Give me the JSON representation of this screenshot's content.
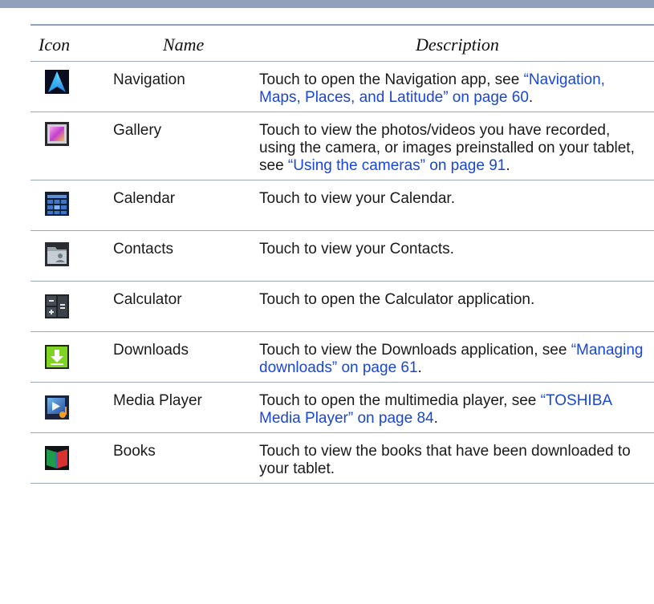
{
  "table": {
    "headers": {
      "icon": "Icon",
      "name": "Name",
      "description": "Description"
    },
    "rows": [
      {
        "icon": "navigation-arrow-icon",
        "name": "Navigation",
        "desc_prefix": "Touch to open the Navigation app, see ",
        "desc_link": "“Navigation, Maps, Places, and Latitude” on page 60",
        "desc_suffix": "."
      },
      {
        "icon": "gallery-picture-icon",
        "name": "Gallery",
        "desc_prefix": "Touch to view the photos/videos you have recorded, using the camera, or images preinstalled on your tablet, see ",
        "desc_link": "“Using the cameras” on page 91",
        "desc_suffix": "."
      },
      {
        "icon": "calendar-grid-icon",
        "name": "Calendar",
        "desc_prefix": "Touch to view your Calendar.",
        "desc_link": "",
        "desc_suffix": ""
      },
      {
        "icon": "contacts-folder-icon",
        "name": "Contacts",
        "desc_prefix": "Touch to view your Contacts.",
        "desc_link": "",
        "desc_suffix": ""
      },
      {
        "icon": "calculator-keys-icon",
        "name": "Calculator",
        "desc_prefix": "Touch to open the Calculator application.",
        "desc_link": "",
        "desc_suffix": ""
      },
      {
        "icon": "download-arrow-icon",
        "name": "Downloads",
        "desc_prefix": "Touch to view the Downloads application, see ",
        "desc_link": "“Managing downloads” on page 61",
        "desc_suffix": "."
      },
      {
        "icon": "media-player-film-icon",
        "name": "Media Player",
        "desc_prefix": "Touch to open the multimedia player, see ",
        "desc_link": "“TOSHIBA Media Player” on page 84",
        "desc_suffix": "."
      },
      {
        "icon": "books-open-icon",
        "name": "Books",
        "desc_prefix": "Touch to view the books that have been downloaded to your tablet.",
        "desc_link": "",
        "desc_suffix": ""
      }
    ]
  },
  "colors": {
    "rule": "#8fa1bd",
    "link": "#1a46d6"
  }
}
